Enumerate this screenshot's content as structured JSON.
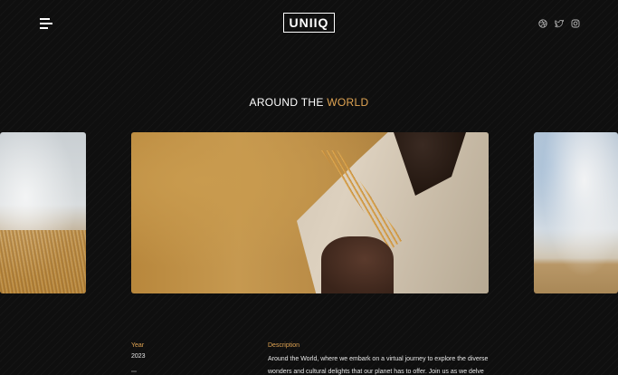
{
  "header": {
    "logo": "UNIIQ",
    "icons": [
      "dribbble-icon",
      "twitter-icon",
      "instagram-icon"
    ]
  },
  "section": {
    "title_main": "AROUND THE ",
    "title_accent": "WORLD"
  },
  "colors": {
    "accent": "#e0a453",
    "background": "#0f0f0f"
  },
  "details": {
    "year_label": "Year",
    "year_value": "2023",
    "description_label": "Description",
    "description_text": "Around the World, where we embark on a virtual journey to explore the diverse wonders and cultural delights that our planet has to offer. Join us as we delve into"
  }
}
